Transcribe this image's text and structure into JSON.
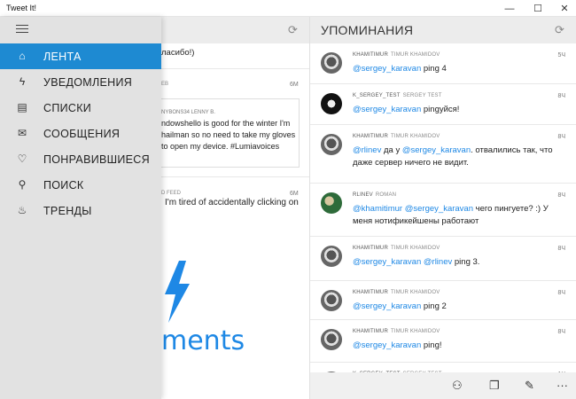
{
  "window": {
    "title": "Tweet It!",
    "minimize": "—",
    "maximize": "☐",
    "close": "✕"
  },
  "left_column": {
    "texts": [
      "ласибо!)",
      "EB",
      "NYBONS34 LENNY B.",
      "6M",
      "ndowshello is good for the winter I'm",
      "hailman so no need to take my gloves",
      "to open my device. #Lumiavoices",
      "D FEED",
      "6M",
      "I'm tired of accidentally clicking on",
      "ments"
    ]
  },
  "mentions": {
    "title": "УПОМИНАНИЯ",
    "items": [
      {
        "name": "KHAMITIMUR",
        "sn": "TIMUR KHAMIDOV",
        "time": "5Ч",
        "parts": [
          [
            "@sergey_karavan",
            true
          ],
          [
            " ping 4",
            false
          ]
        ]
      },
      {
        "name": "K_SERGEY_TEST",
        "sn": "SERGEY TEST",
        "time": "8Ч",
        "parts": [
          [
            "@sergey_karavan",
            true
          ],
          [
            " pingуйся!",
            false
          ]
        ]
      },
      {
        "name": "KHAMITIMUR",
        "sn": "TIMUR KHAMIDOV",
        "time": "8Ч",
        "parts": [
          [
            "@rlinev",
            true
          ],
          [
            " да у ",
            false
          ],
          [
            "@sergey_karavan",
            true
          ],
          [
            ". отвалились так, что даже сервер ничего не видит.",
            false
          ]
        ]
      },
      {
        "name": "RLINEV",
        "sn": "ROMAN",
        "time": "8Ч",
        "parts": [
          [
            "@khamitimur",
            true
          ],
          [
            " ",
            false
          ],
          [
            "@sergey_karavan",
            true
          ],
          [
            " чего пингуете? :) У меня нотификейшены работают",
            false
          ]
        ]
      },
      {
        "name": "KHAMITIMUR",
        "sn": "TIMUR KHAMIDOV",
        "time": "8Ч",
        "parts": [
          [
            "@sergey_karavan",
            true
          ],
          [
            " ",
            false
          ],
          [
            "@rlinev",
            true
          ],
          [
            " ping 3.",
            false
          ]
        ]
      },
      {
        "name": "KHAMITIMUR",
        "sn": "TIMUR KHAMIDOV",
        "time": "8Ч",
        "parts": [
          [
            "@sergey_karavan",
            true
          ],
          [
            " ping 2",
            false
          ]
        ]
      },
      {
        "name": "KHAMITIMUR",
        "sn": "TIMUR KHAMIDOV",
        "time": "8Ч",
        "parts": [
          [
            "@sergey_karavan",
            true
          ],
          [
            " ping!",
            false
          ]
        ]
      },
      {
        "name": "K_SERGEY_TEST",
        "sn": "SERGEY TEST",
        "time": "1Ч",
        "parts": []
      }
    ]
  },
  "nav": {
    "items": [
      {
        "label": "ЛЕНТА",
        "icon": "home-icon",
        "glyph": "⌂",
        "active": true
      },
      {
        "label": "УВЕДОМЛЕНИЯ",
        "icon": "lightning-icon",
        "glyph": "ϟ",
        "active": false
      },
      {
        "label": "СПИСКИ",
        "icon": "list-icon",
        "glyph": "▤",
        "active": false
      },
      {
        "label": "СООБЩЕНИЯ",
        "icon": "mail-icon",
        "glyph": "✉",
        "active": false
      },
      {
        "label": "ПОНРАВИВШИЕСЯ",
        "icon": "heart-icon",
        "glyph": "♡",
        "active": false
      },
      {
        "label": "ПОИСК",
        "icon": "search-icon",
        "glyph": "⚲",
        "active": false
      },
      {
        "label": "ТРЕНДЫ",
        "icon": "flame-icon",
        "glyph": "♨",
        "active": false
      }
    ]
  },
  "bottombar": [
    {
      "icon": "profile-icon",
      "glyph": "⚇"
    },
    {
      "icon": "copy-icon",
      "glyph": "❐"
    },
    {
      "icon": "compose-icon",
      "glyph": "✎"
    },
    {
      "icon": "more-icon",
      "glyph": "···"
    }
  ],
  "colors": {
    "accent": "#1e8ad2",
    "mention": "#1e88e5"
  }
}
